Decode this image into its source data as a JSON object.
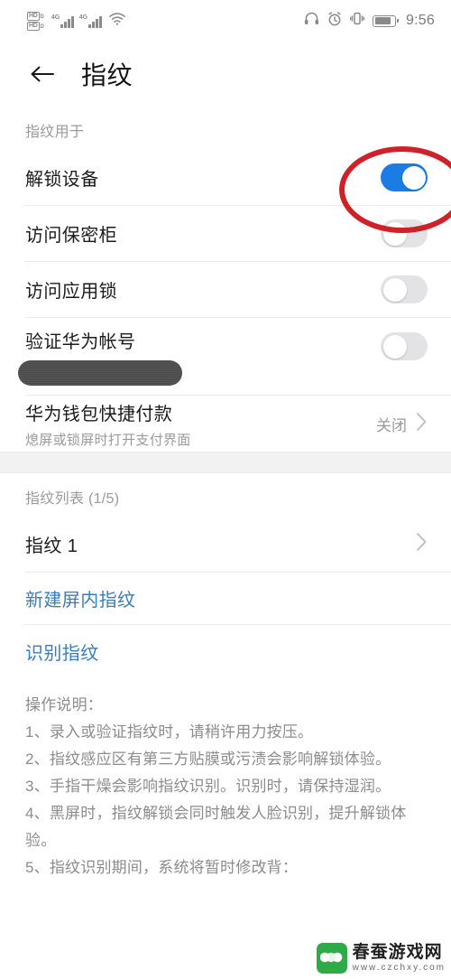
{
  "status_bar": {
    "hd_badges": [
      "HD",
      "HD"
    ],
    "hd_sub_labels": [
      "D",
      "D"
    ],
    "network_labels": [
      "4G",
      "4G"
    ],
    "icons": [
      "hd-volte-icon",
      "signal-bars-icon",
      "signal-bars-icon",
      "wifi-icon",
      "headset-icon",
      "alarm-icon",
      "vibrate-icon",
      "battery-icon"
    ],
    "time": "9:56"
  },
  "appbar": {
    "back_icon": "back-arrow-icon",
    "title": "指纹"
  },
  "usage_section": {
    "label": "指纹用于",
    "rows": [
      {
        "title": "解锁设备",
        "control": "toggle",
        "state": "on"
      },
      {
        "title": "访问保密柜",
        "control": "toggle",
        "state": "off"
      },
      {
        "title": "访问应用锁",
        "control": "toggle",
        "state": "off"
      },
      {
        "title": "验证华为帐号",
        "control": "toggle",
        "state": "off",
        "redacted": true
      },
      {
        "title": "华为钱包快捷付款",
        "subtitle": "熄屏或锁屏时打开支付界面",
        "control": "value-chevron",
        "value": "关闭"
      }
    ]
  },
  "list_section": {
    "label": "指纹列表 (1/5)",
    "rows": [
      {
        "title": "指纹 1",
        "control": "chevron"
      }
    ],
    "actions": [
      {
        "label": "新建屏内指纹"
      },
      {
        "label": "识别指纹"
      }
    ]
  },
  "instructions": {
    "heading": "操作说明：",
    "lines": [
      "1、录入或验证指纹时，请稍许用力按压。",
      "2、指纹感应区有第三方贴膜或污渍会影响解锁体验。",
      "3、手指干燥会影响指纹识别。识别时，请保持湿润。",
      "4、黑屏时，指纹解锁会同时触发人脸识别，提升解锁体验。",
      "5、指纹识别期间，系统将暂时修改背："
    ]
  },
  "annotation": {
    "shape": "red-ellipse",
    "target": "unlock-device-toggle",
    "color": "#cf2128"
  },
  "watermark": {
    "title": "春蚕游戏网",
    "url": "www.czchxy.com",
    "logo_color": "#2faa48"
  },
  "colors": {
    "toggle_on": "#1b7ce6",
    "toggle_off": "#e3e3e5",
    "action_link": "#3a7dbd",
    "secondary_text": "#9a9a9a"
  }
}
